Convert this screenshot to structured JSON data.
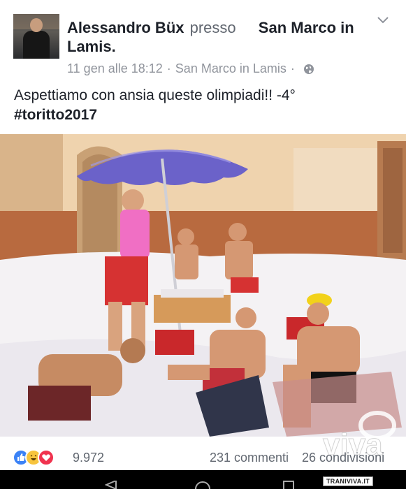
{
  "post": {
    "author": "Alessandro Büx",
    "connector": "presso",
    "place_part1": "San Marco in",
    "place_part2": "Lamis.",
    "date": "11 gen alle 18:12",
    "separator": "·",
    "location": "San Marco in Lamis",
    "separator2": "·",
    "text": "Aspettiamo con ansia queste olimpiadi!! -4°",
    "hashtag": "#toritto2017"
  },
  "reactions": {
    "count": "9.972",
    "comments": "231 commenti",
    "shares": "26 condivisioni",
    "icons": [
      "like-icon",
      "haha-icon",
      "love-icon"
    ]
  },
  "watermark": {
    "logo": "viva",
    "site": "TRANIVIVA.IT"
  },
  "colors": {
    "like": "#3b82f6",
    "haha": "#f7c43d",
    "love": "#f0334f",
    "umbrella": "#6b62c9",
    "snow": "#f4f2f4"
  }
}
